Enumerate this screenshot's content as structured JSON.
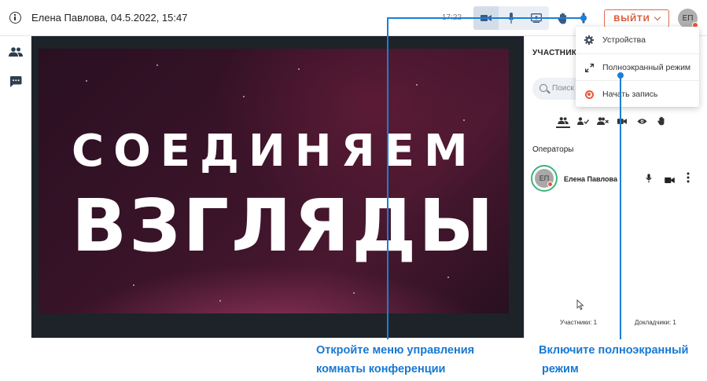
{
  "header": {
    "conference_title": "Елена Павлова, 04.5.2022, 15:47",
    "clock": "17:22",
    "logout_label": "ВЫЙТИ",
    "avatar_initials": "ЕП"
  },
  "slide": {
    "line1": "СОЕДИНЯЕМ",
    "line2": "ВЗГЛЯДЫ"
  },
  "panel": {
    "title": "УЧАСТНИК",
    "search_placeholder": "Поиск",
    "section_operators": "Операторы",
    "participant": {
      "initials": "ЕП",
      "name": "Елена Павлова"
    },
    "participants_count": "Участники: 1",
    "speakers_count": "Докладчики: 1"
  },
  "menu": {
    "items": [
      {
        "label": "Устройства",
        "icon": "gear-icon"
      },
      {
        "label": "Полноэкранный режим",
        "icon": "fullscreen-icon"
      },
      {
        "label": "Начать запись",
        "icon": "record-icon"
      }
    ]
  },
  "annotations": {
    "left_line1": "Откройте меню управления",
    "left_line2": "комнаты конференции",
    "right_line1": "Включите полноэкранный",
    "right_line2": " режим"
  },
  "colors": {
    "accent_red": "#d9532f",
    "callout_blue": "#1a7fd6",
    "active_green": "#3cb57a"
  }
}
